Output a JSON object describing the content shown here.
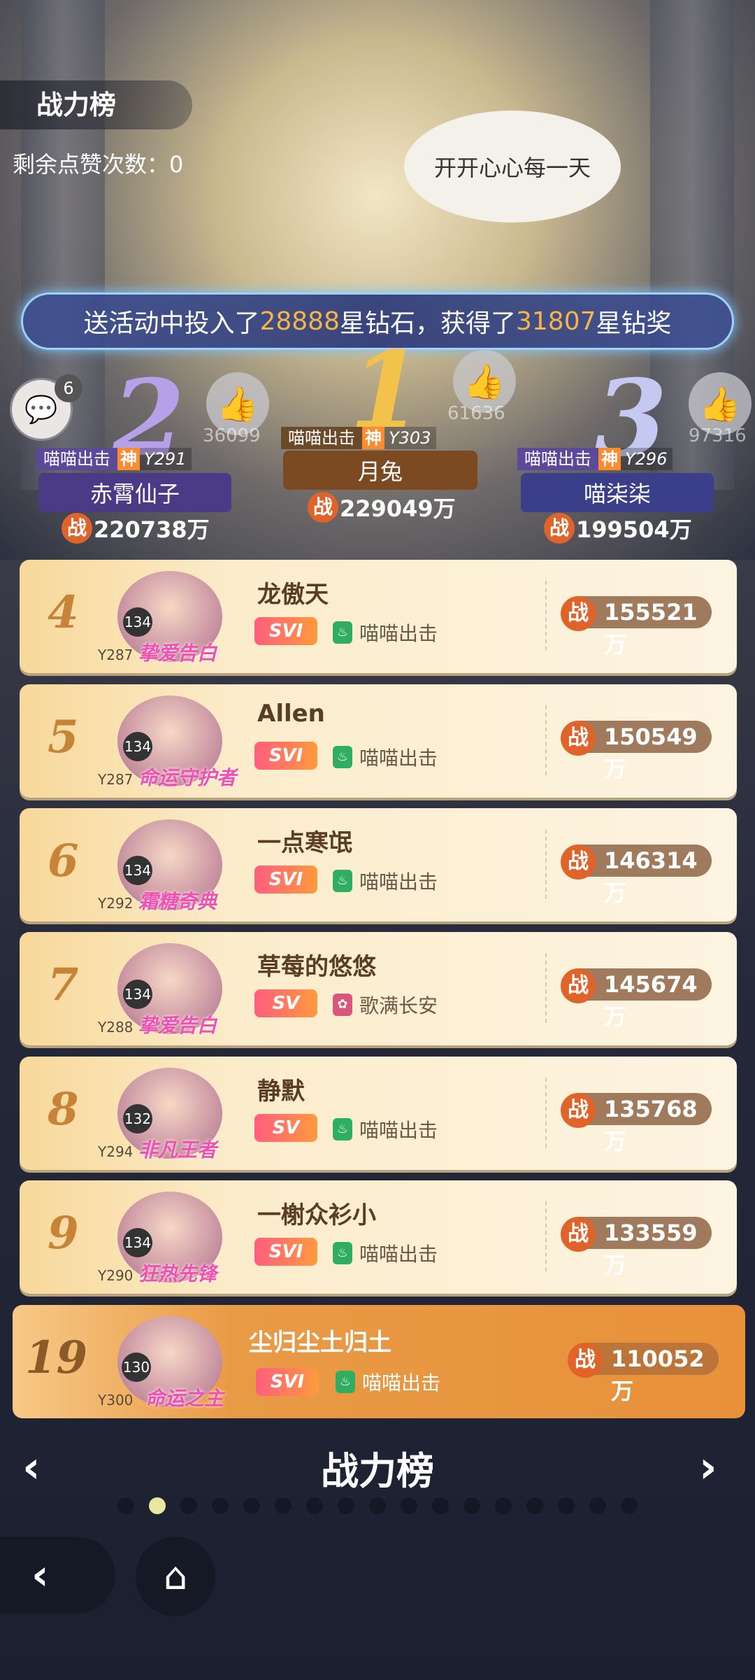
{
  "header": {
    "title": "战力榜",
    "remaining_likes": "剩余点赞次数：0",
    "speech_bubble": "开开心心每一天"
  },
  "banner": {
    "prefix": "送活动中投入了",
    "amount1": "28888",
    "mid": "星钻石，获得了",
    "amount2": "31807",
    "suffix": "星钻奖"
  },
  "chat": {
    "badge": "6"
  },
  "podium": [
    {
      "rank": "2",
      "likes": "36099",
      "guild": "喵喵出击",
      "shen": "神",
      "yid": "Y291",
      "name": "赤霄仙子",
      "power": "220738万"
    },
    {
      "rank": "1",
      "likes": "61636",
      "guild": "喵喵出击",
      "shen": "神",
      "yid": "Y303",
      "name": "月兔",
      "power": "229049万"
    },
    {
      "rank": "3",
      "likes": "97316",
      "guild": "喵喵出击",
      "shen": "神",
      "yid": "Y296",
      "name": "喵柒柒",
      "power": "199504万"
    }
  ],
  "zhan": "战",
  "rows": [
    {
      "rank": "4",
      "level": "134",
      "yid": "Y287",
      "title": "挚爱告白",
      "name": "龙傲天",
      "vip": "SVI",
      "guild": "喵喵出击",
      "power": "155521万"
    },
    {
      "rank": "5",
      "level": "134",
      "yid": "Y287",
      "title": "命运守护者",
      "name": "Allen",
      "vip": "SVI",
      "guild": "喵喵出击",
      "power": "150549万"
    },
    {
      "rank": "6",
      "level": "134",
      "yid": "Y292",
      "title": "霜糖奇典",
      "name": "一点寒氓",
      "vip": "SVI",
      "guild": "喵喵出击",
      "power": "146314万"
    },
    {
      "rank": "7",
      "level": "134",
      "yid": "Y288",
      "title": "挚爱告白",
      "name": "草莓的悠悠",
      "vip": "SV",
      "guild": "歌满长安",
      "power": "145674万"
    },
    {
      "rank": "8",
      "level": "132",
      "yid": "Y294",
      "title": "非凡王者",
      "name": "静默",
      "vip": "SV",
      "guild": "喵喵出击",
      "power": "135768万"
    },
    {
      "rank": "9",
      "level": "134",
      "yid": "Y290",
      "title": "狂热先锋",
      "name": "一榭众衫小",
      "vip": "SVI",
      "guild": "喵喵出击",
      "power": "133559万"
    }
  ],
  "me": {
    "rank": "19",
    "level": "130",
    "yid": "Y300",
    "title": "命运之主",
    "name": "尘归尘土归土",
    "vip": "SVI",
    "guild": "喵喵出击",
    "power": "110052万"
  },
  "footer": {
    "nav_title": "战力榜",
    "prev": "‹",
    "next": "›",
    "back": "‹",
    "home": "⌂"
  }
}
